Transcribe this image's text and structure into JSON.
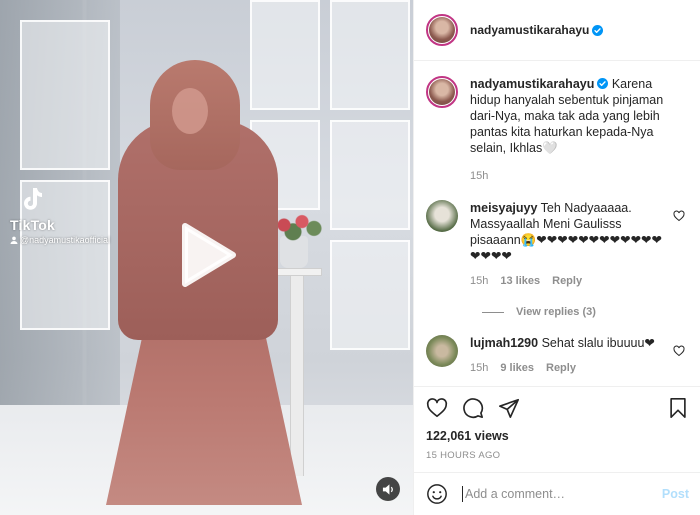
{
  "post": {
    "author": {
      "username": "nadyamustikarahayu",
      "verified": true,
      "avatar": "profile-photo"
    },
    "media": {
      "type": "video",
      "watermark_brand": "TikTok",
      "watermark_handle": "@nadyamustikaofficial",
      "play_icon": "play-icon",
      "sound_icon": "volume-icon"
    },
    "caption": {
      "username": "nadyamustikarahayu",
      "text": "Karena hidup hanyalah sebentuk pinjaman dari-Nya, maka tak ada yang lebih pantas kita haturkan kepada-Nya selain, Ikhlas🤍",
      "time": "15h"
    },
    "comments": [
      {
        "username": "meisyajuyy",
        "text": "Teh Nadyaaaaa. Massyaallah Meni Gaulisss pisaaann😭❤❤❤❤❤❤❤❤❤❤❤❤❤❤❤❤",
        "time": "15h",
        "likes": "13 likes",
        "reply": "Reply",
        "view_replies": "View replies (3)"
      },
      {
        "username": "lujmah1290",
        "text": "Sehat slalu ibuuuu❤",
        "time": "15h",
        "likes": "9 likes",
        "reply": "Reply"
      }
    ],
    "stats": {
      "views": "122,061 views",
      "ago": "15 HOURS AGO"
    },
    "composer": {
      "placeholder": "Add a comment…",
      "post_label": "Post"
    },
    "colors": {
      "verified_blue": "#0095f6",
      "story_ring": "#c13584",
      "like_red": "#ed4956",
      "post_disabled": "#b2dffc"
    }
  }
}
